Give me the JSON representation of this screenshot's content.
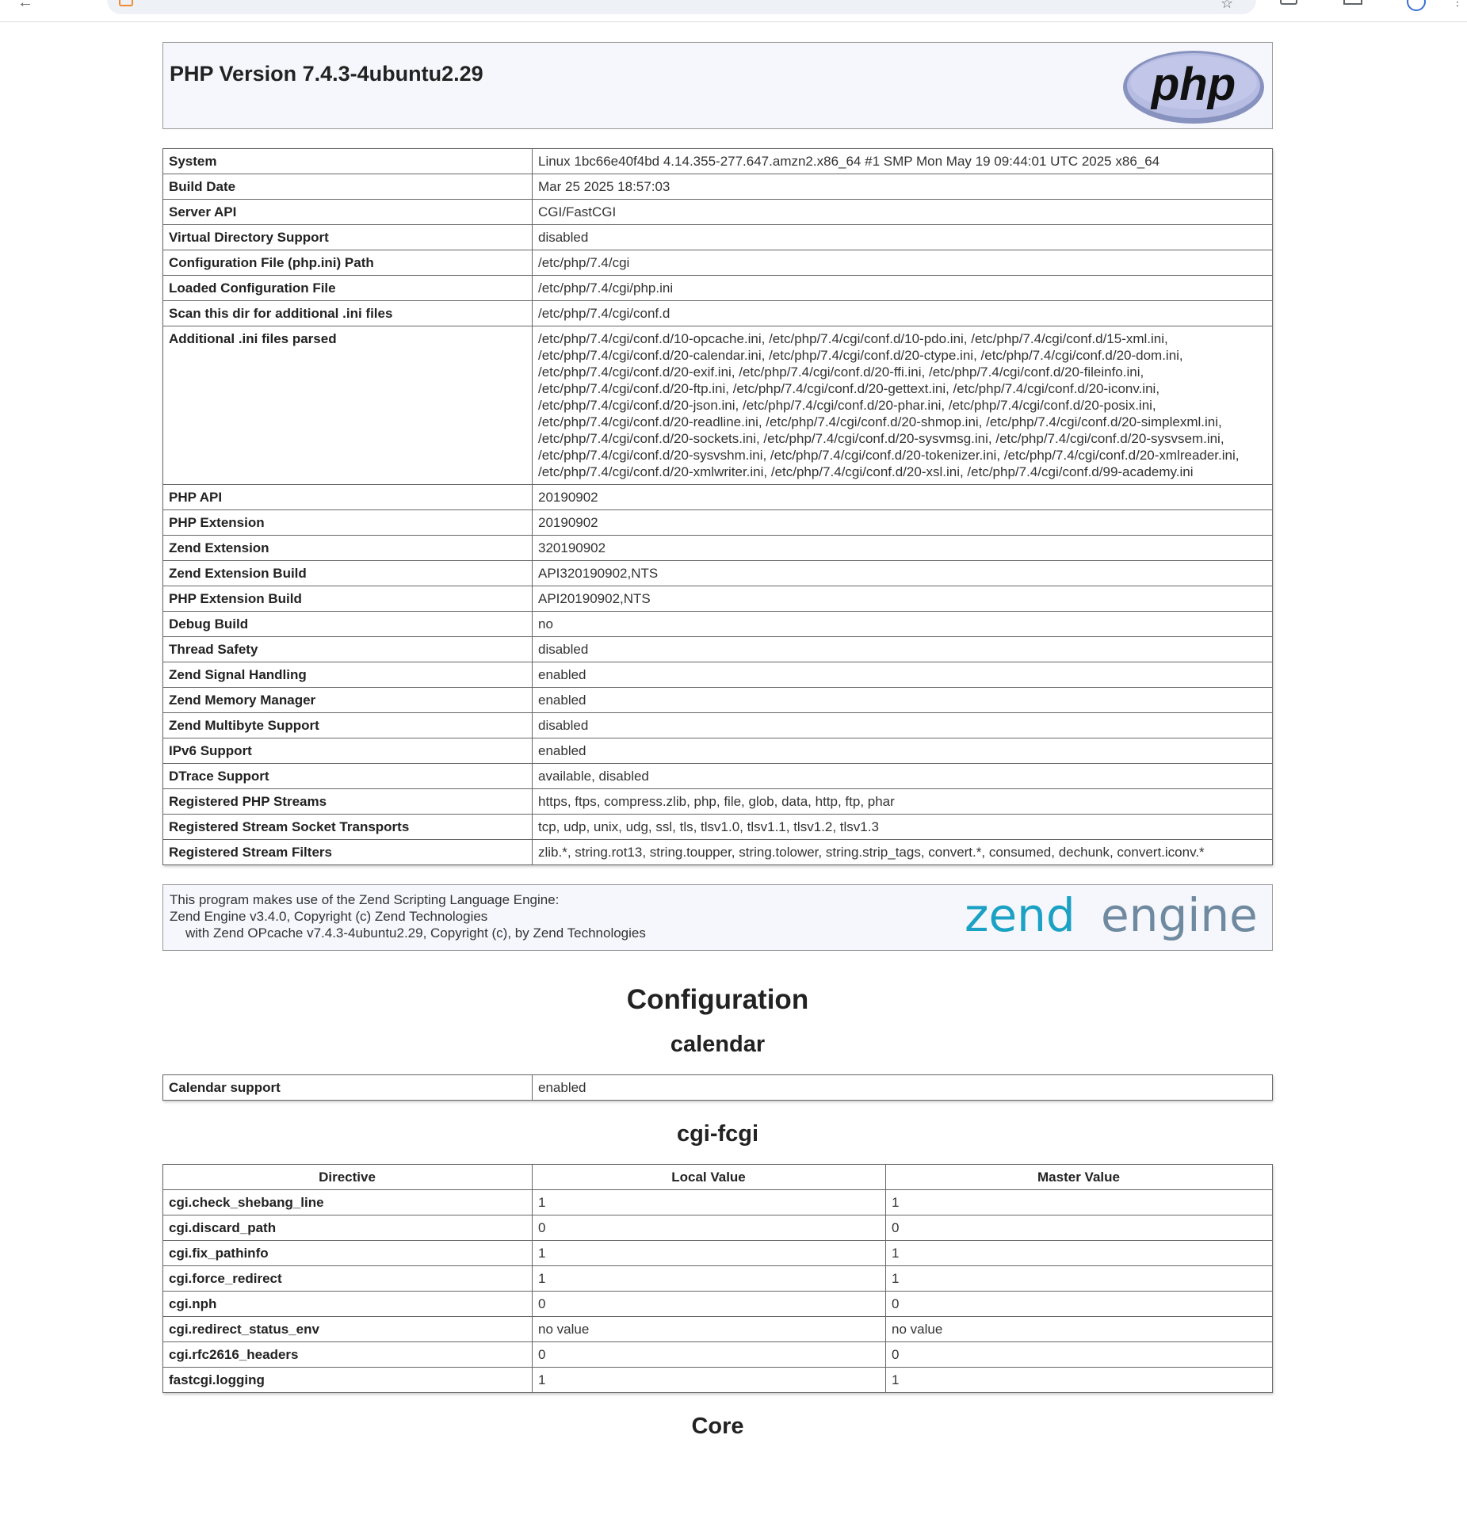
{
  "header": {
    "title": "PHP Version 7.4.3-4ubuntu2.29",
    "logo_text": "php"
  },
  "system_info": [
    {
      "label": "System",
      "value": "Linux 1bc66e40f4bd 4.14.355-277.647.amzn2.x86_64 #1 SMP Mon May 19 09:44:01 UTC 2025 x86_64"
    },
    {
      "label": "Build Date",
      "value": "Mar 25 2025 18:57:03"
    },
    {
      "label": "Server API",
      "value": "CGI/FastCGI"
    },
    {
      "label": "Virtual Directory Support",
      "value": "disabled"
    },
    {
      "label": "Configuration File (php.ini) Path",
      "value": "/etc/php/7.4/cgi"
    },
    {
      "label": "Loaded Configuration File",
      "value": "/etc/php/7.4/cgi/php.ini"
    },
    {
      "label": "Scan this dir for additional .ini files",
      "value": "/etc/php/7.4/cgi/conf.d"
    },
    {
      "label": "Additional .ini files parsed",
      "value": "/etc/php/7.4/cgi/conf.d/10-opcache.ini, /etc/php/7.4/cgi/conf.d/10-pdo.ini, /etc/php/7.4/cgi/conf.d/15-xml.ini, /etc/php/7.4/cgi/conf.d/20-calendar.ini, /etc/php/7.4/cgi/conf.d/20-ctype.ini, /etc/php/7.4/cgi/conf.d/20-dom.ini, /etc/php/7.4/cgi/conf.d/20-exif.ini, /etc/php/7.4/cgi/conf.d/20-ffi.ini, /etc/php/7.4/cgi/conf.d/20-fileinfo.ini, /etc/php/7.4/cgi/conf.d/20-ftp.ini, /etc/php/7.4/cgi/conf.d/20-gettext.ini, /etc/php/7.4/cgi/conf.d/20-iconv.ini, /etc/php/7.4/cgi/conf.d/20-json.ini, /etc/php/7.4/cgi/conf.d/20-phar.ini, /etc/php/7.4/cgi/conf.d/20-posix.ini, /etc/php/7.4/cgi/conf.d/20-readline.ini, /etc/php/7.4/cgi/conf.d/20-shmop.ini, /etc/php/7.4/cgi/conf.d/20-simplexml.ini, /etc/php/7.4/cgi/conf.d/20-sockets.ini, /etc/php/7.4/cgi/conf.d/20-sysvmsg.ini, /etc/php/7.4/cgi/conf.d/20-sysvsem.ini, /etc/php/7.4/cgi/conf.d/20-sysvshm.ini, /etc/php/7.4/cgi/conf.d/20-tokenizer.ini, /etc/php/7.4/cgi/conf.d/20-xmlreader.ini, /etc/php/7.4/cgi/conf.d/20-xmlwriter.ini, /etc/php/7.4/cgi/conf.d/20-xsl.ini, /etc/php/7.4/cgi/conf.d/99-academy.ini"
    },
    {
      "label": "PHP API",
      "value": "20190902"
    },
    {
      "label": "PHP Extension",
      "value": "20190902"
    },
    {
      "label": "Zend Extension",
      "value": "320190902"
    },
    {
      "label": "Zend Extension Build",
      "value": "API320190902,NTS"
    },
    {
      "label": "PHP Extension Build",
      "value": "API20190902,NTS"
    },
    {
      "label": "Debug Build",
      "value": "no"
    },
    {
      "label": "Thread Safety",
      "value": "disabled"
    },
    {
      "label": "Zend Signal Handling",
      "value": "enabled"
    },
    {
      "label": "Zend Memory Manager",
      "value": "enabled"
    },
    {
      "label": "Zend Multibyte Support",
      "value": "disabled"
    },
    {
      "label": "IPv6 Support",
      "value": "enabled"
    },
    {
      "label": "DTrace Support",
      "value": "available, disabled"
    },
    {
      "label": "Registered PHP Streams",
      "value": "https, ftps, compress.zlib, php, file, glob, data, http, ftp, phar"
    },
    {
      "label": "Registered Stream Socket Transports",
      "value": "tcp, udp, unix, udg, ssl, tls, tlsv1.0, tlsv1.1, tlsv1.2, tlsv1.3"
    },
    {
      "label": "Registered Stream Filters",
      "value": "zlib.*, string.rot13, string.toupper, string.tolower, string.strip_tags, convert.*, consumed, dechunk, convert.iconv.*"
    }
  ],
  "zend": {
    "line1": "This program makes use of the Zend Scripting Language Engine:",
    "line2": "Zend Engine v3.4.0, Copyright (c) Zend Technologies",
    "line3": "with Zend OPcache v7.4.3-4ubuntu2.29, Copyright (c), by Zend Technologies",
    "logo_word1": "zend",
    "logo_word2": "engine"
  },
  "configuration": {
    "title": "Configuration",
    "calendar": {
      "title": "calendar",
      "rows": [
        {
          "label": "Calendar support",
          "value": "enabled"
        }
      ]
    },
    "cgi_fcgi": {
      "title": "cgi-fcgi",
      "headers": [
        "Directive",
        "Local Value",
        "Master Value"
      ],
      "rows": [
        {
          "directive": "cgi.check_shebang_line",
          "local": "1",
          "master": "1"
        },
        {
          "directive": "cgi.discard_path",
          "local": "0",
          "master": "0"
        },
        {
          "directive": "cgi.fix_pathinfo",
          "local": "1",
          "master": "1"
        },
        {
          "directive": "cgi.force_redirect",
          "local": "1",
          "master": "1"
        },
        {
          "directive": "cgi.nph",
          "local": "0",
          "master": "0"
        },
        {
          "directive": "cgi.redirect_status_env",
          "local": "no value",
          "master": "no value"
        },
        {
          "directive": "cgi.rfc2616_headers",
          "local": "0",
          "master": "0"
        },
        {
          "directive": "fastcgi.logging",
          "local": "1",
          "master": "1"
        }
      ]
    },
    "next_section_title": "Core"
  },
  "colors": {
    "label_cell": "#ffffff",
    "border": "#666666",
    "php_logo_fill": "#8892bf",
    "zend_teal": "#1aa1c4",
    "zend_gray": "#6f8aa0"
  }
}
